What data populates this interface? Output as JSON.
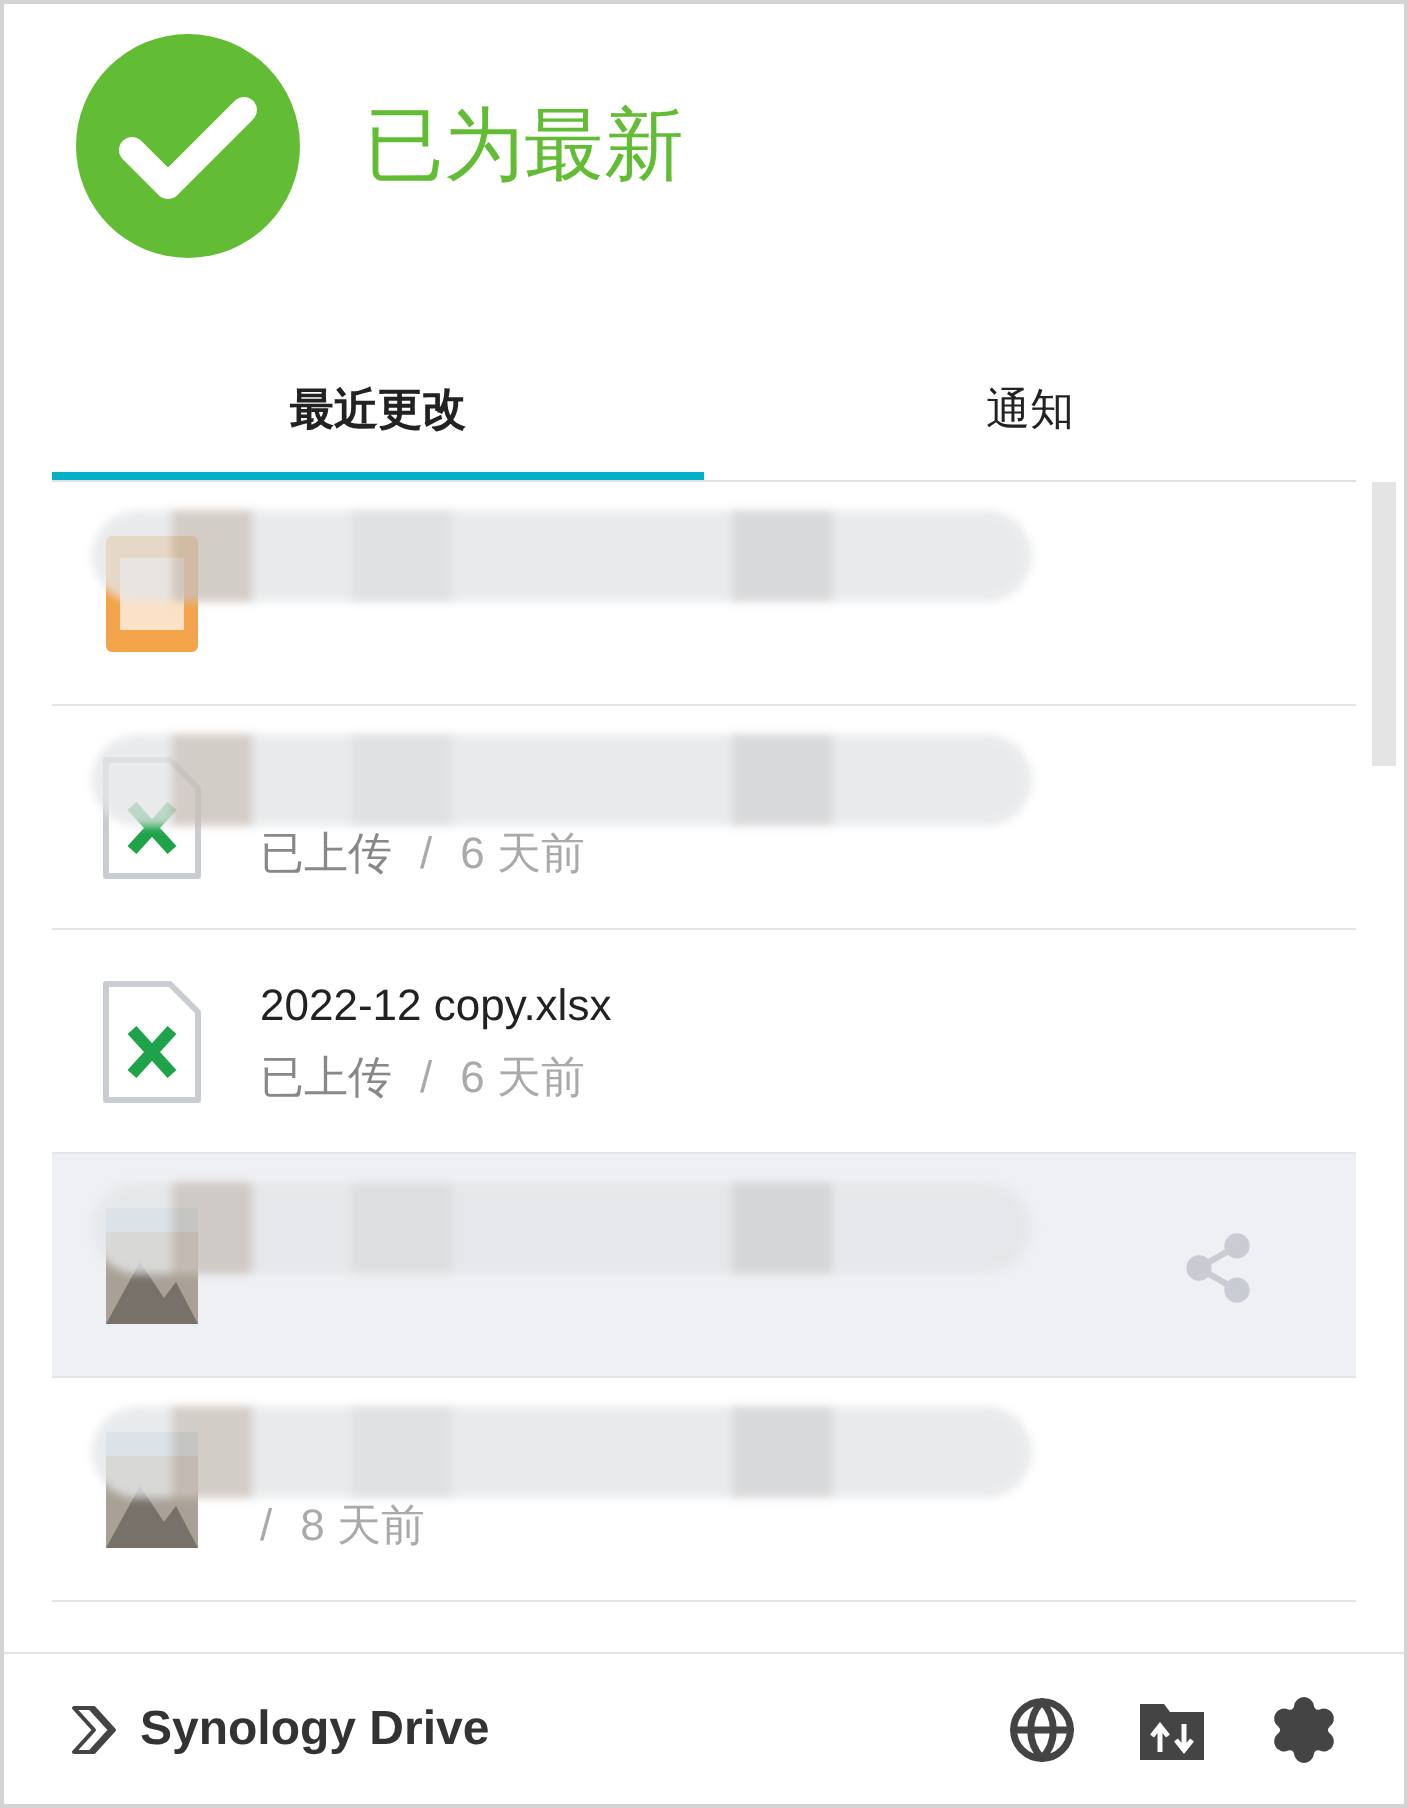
{
  "status": {
    "title": "已为最新",
    "ok": true
  },
  "tabs": [
    {
      "label": "最近更改",
      "selected": true
    },
    {
      "label": "通知",
      "selected": false
    }
  ],
  "items": [
    {
      "kind": "download",
      "redacted": true,
      "selected": false,
      "share": false
    },
    {
      "kind": "excel",
      "redacted": true,
      "status": "已上传",
      "separator": "/",
      "time": "6 天前",
      "selected": false,
      "share": false
    },
    {
      "kind": "excel",
      "redacted": false,
      "name": "2022-12 copy.xlsx",
      "status": "已上传",
      "separator": "/",
      "time": "6 天前",
      "selected": false,
      "share": false
    },
    {
      "kind": "picture",
      "redacted": true,
      "selected": true,
      "share": true
    },
    {
      "kind": "picture",
      "redacted": true,
      "separator": "/",
      "time": "8 天前",
      "selected": false,
      "share": false
    }
  ],
  "footer": {
    "brand": "Synology Drive"
  }
}
